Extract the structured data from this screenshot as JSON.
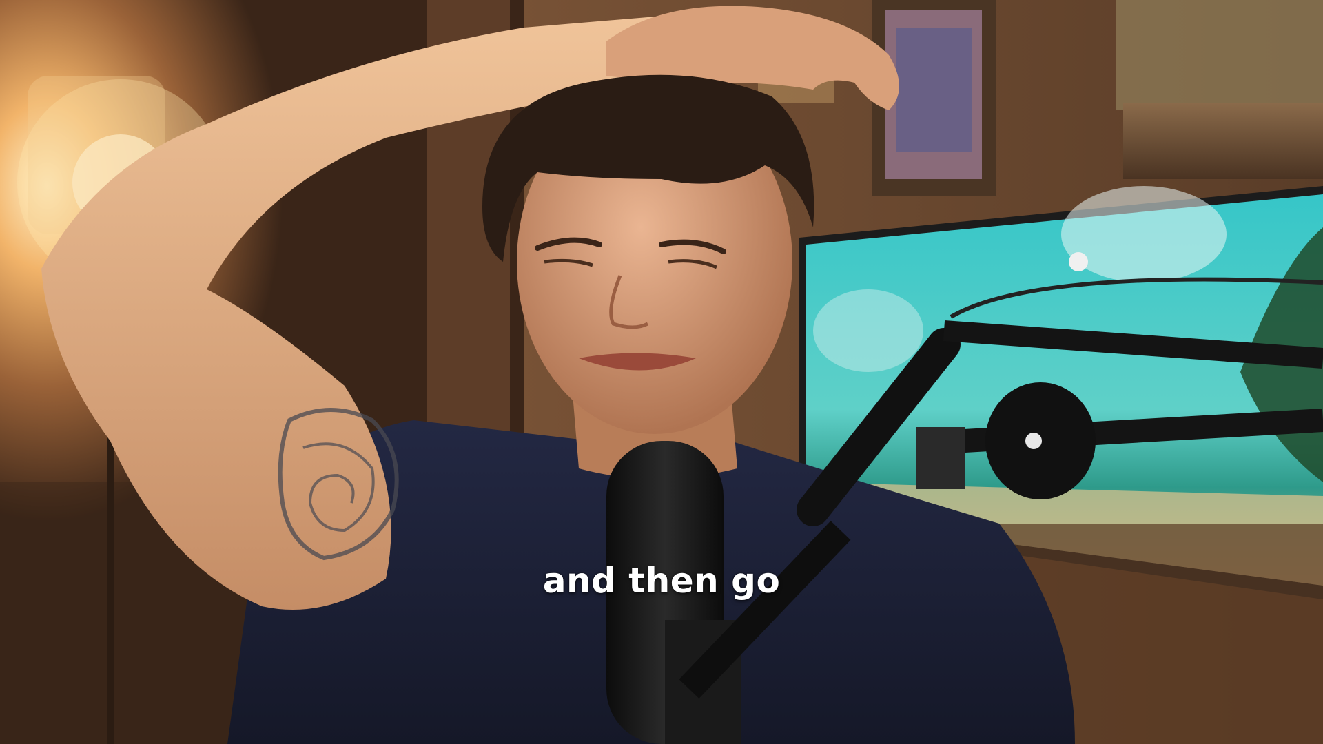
{
  "video": {
    "caption": "and then go"
  },
  "scene": {
    "colors": {
      "wall_left": "#8a5a32",
      "lamp_glow": "#ffd08a",
      "wall_right": "#6e4a30",
      "screen_sky": "#3fc4c4",
      "shirt": "#1c2033",
      "skin": "#d9a07a",
      "hair": "#2a1c14",
      "mic_black": "#151515",
      "tattoo": "#4a4a52"
    },
    "icons": [
      "microphone",
      "mic-boom-arm",
      "wall-lamp",
      "picture-frame",
      "tv-screen"
    ]
  }
}
